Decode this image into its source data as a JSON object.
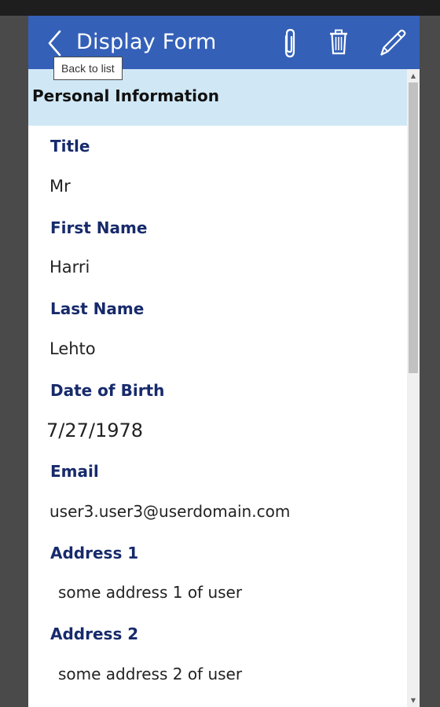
{
  "header": {
    "title": "Display Form",
    "back_tooltip": "Back to list",
    "icons": {
      "back": "chevron-left-icon",
      "attach": "paperclip-icon",
      "delete": "trash-icon",
      "edit": "pencil-icon"
    },
    "background_color": "#3460b8"
  },
  "section": {
    "title": "Personal Information",
    "background_color": "#d0e8f5"
  },
  "fields": [
    {
      "label": "Title",
      "value": "Mr"
    },
    {
      "label": "First Name",
      "value": "Harri"
    },
    {
      "label": "Last Name",
      "value": "Lehto"
    },
    {
      "label": "Date of Birth",
      "value": "7/27/1978"
    },
    {
      "label": "Email",
      "value": "user3.user3@userdomain.com"
    },
    {
      "label": "Address 1",
      "value": "some address 1 of user"
    },
    {
      "label": "Address 2",
      "value": "some address 2 of user"
    }
  ],
  "scrollbar": {
    "up_glyph": "▲",
    "down_glyph": "▼"
  },
  "colors": {
    "label": "#172a6b",
    "value": "#222222"
  }
}
